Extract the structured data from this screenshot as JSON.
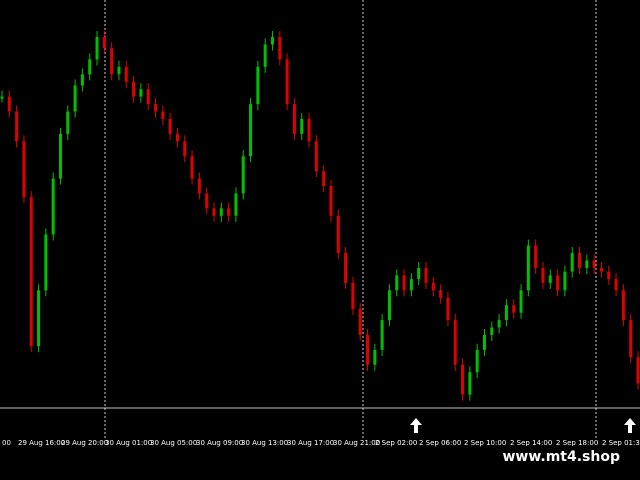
{
  "colors": {
    "background": "#000000",
    "bull_candle": "#00c000",
    "bear_candle": "#e00000",
    "grid": "#ffffff",
    "axis_text": "#ffffff",
    "arrow": "#ffffff"
  },
  "time_axis": {
    "labels": [
      "00",
      "29 Aug 16:00",
      "29 Aug 20:00",
      "30 Aug 01:00",
      "30 Aug 05:00",
      "30 Aug 09:00",
      "30 Aug 13:00",
      "30 Aug 17:00",
      "30 Aug 21:00",
      "2 Sep 02:00",
      "2 Sep 06:00",
      "2 Sep 10:00",
      "2 Sep 14:00",
      "2 Sep 18:00",
      "2 Sep 01:30"
    ]
  },
  "markers": {
    "arrows": [
      {
        "name": "buy-signal-arrow",
        "icon": "up-arrow-icon"
      },
      {
        "name": "buy-signal-arrow",
        "icon": "up-arrow-icon"
      }
    ]
  },
  "watermark": {
    "text": "www.mt4.shop"
  },
  "chart_data": {
    "type": "candlestick",
    "series": [
      {
        "name": "",
        "values": [
          0.82,
          0.78,
          0.7,
          0.55,
          0.15,
          0.3,
          0.45,
          0.6,
          0.72,
          0.78,
          0.85,
          0.88,
          0.92,
          0.98,
          0.95,
          0.88,
          0.9,
          0.86,
          0.82,
          0.84,
          0.8,
          0.78,
          0.76,
          0.72,
          0.7,
          0.66,
          0.6,
          0.56,
          0.52,
          0.5,
          0.52,
          0.5,
          0.56,
          0.66,
          0.8,
          0.9,
          0.96,
          0.98,
          0.92,
          0.8,
          0.72,
          0.76,
          0.7,
          0.62,
          0.58,
          0.5,
          0.4,
          0.32,
          0.25,
          0.18,
          0.1,
          0.14,
          0.22,
          0.3,
          0.34,
          0.3,
          0.33,
          0.36,
          0.32,
          0.3,
          0.28,
          0.22,
          0.1,
          0.02,
          0.08,
          0.14,
          0.18,
          0.2,
          0.22,
          0.26,
          0.24,
          0.3,
          0.42,
          0.36,
          0.32,
          0.34,
          0.3,
          0.35,
          0.4,
          0.36,
          0.38,
          0.36,
          0.35,
          0.33,
          0.3,
          0.22,
          0.12,
          0.05
        ]
      }
    ],
    "xlabel": "",
    "ylabel": ""
  }
}
